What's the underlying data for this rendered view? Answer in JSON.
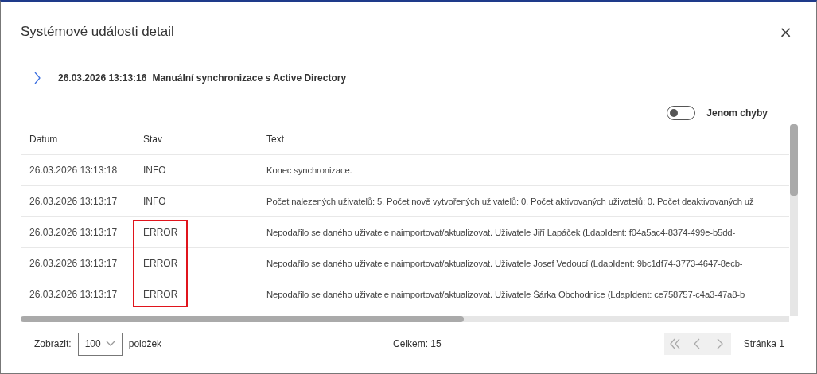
{
  "dialog": {
    "title": "Systémové události detail",
    "close": "×"
  },
  "event": {
    "expanded": false,
    "time": "26.03.2026 13:13:16",
    "name": "Manuální synchronizace s Active Directory"
  },
  "filter": {
    "label": "Jenom chyby",
    "on": false
  },
  "table": {
    "columns": [
      "Datum",
      "Stav",
      "Text"
    ],
    "rows": [
      {
        "date": "26.03.2026 13:13:18",
        "status": "INFO",
        "text": "Konec synchronizace.",
        "highlighted": false
      },
      {
        "date": "26.03.2026 13:13:17",
        "status": "INFO",
        "text": "Počet nalezených uživatelů: 5. Počet nově vytvořených uživatelů: 0. Počet aktivovaných uživatelů: 0. Počet deaktivovaných už",
        "highlighted": false
      },
      {
        "date": "26.03.2026 13:13:17",
        "status": "ERROR",
        "text": "Nepodařilo se daného uživatele naimportovat/aktualizovat. Uživatele Jiří Lapáček (LdapIdent: f04a5ac4-8374-499e-b5dd-",
        "highlighted": true
      },
      {
        "date": "26.03.2026 13:13:17",
        "status": "ERROR",
        "text": "Nepodařilo se daného uživatele naimportovat/aktualizovat. Uživatele Josef Vedoucí (LdapIdent: 9bc1df74-3773-4647-8ecb-",
        "highlighted": true
      },
      {
        "date": "26.03.2026 13:13:17",
        "status": "ERROR",
        "text": "Nepodařilo se daného uživatele naimportovat/aktualizovat. Uživatele Šárka Obchodnice (LdapIdent: ce758757-c4a3-47a8-b",
        "highlighted": true
      }
    ]
  },
  "footer": {
    "show_label": "Zobrazit:",
    "page_size": "100",
    "items_label": "položek",
    "total": "Celkem: 15",
    "pager": [
      {
        "kind": "first",
        "disabled": true
      },
      {
        "kind": "prev",
        "disabled": true
      },
      {
        "kind": "next",
        "disabled": true
      }
    ],
    "page": "Stránka 1"
  }
}
